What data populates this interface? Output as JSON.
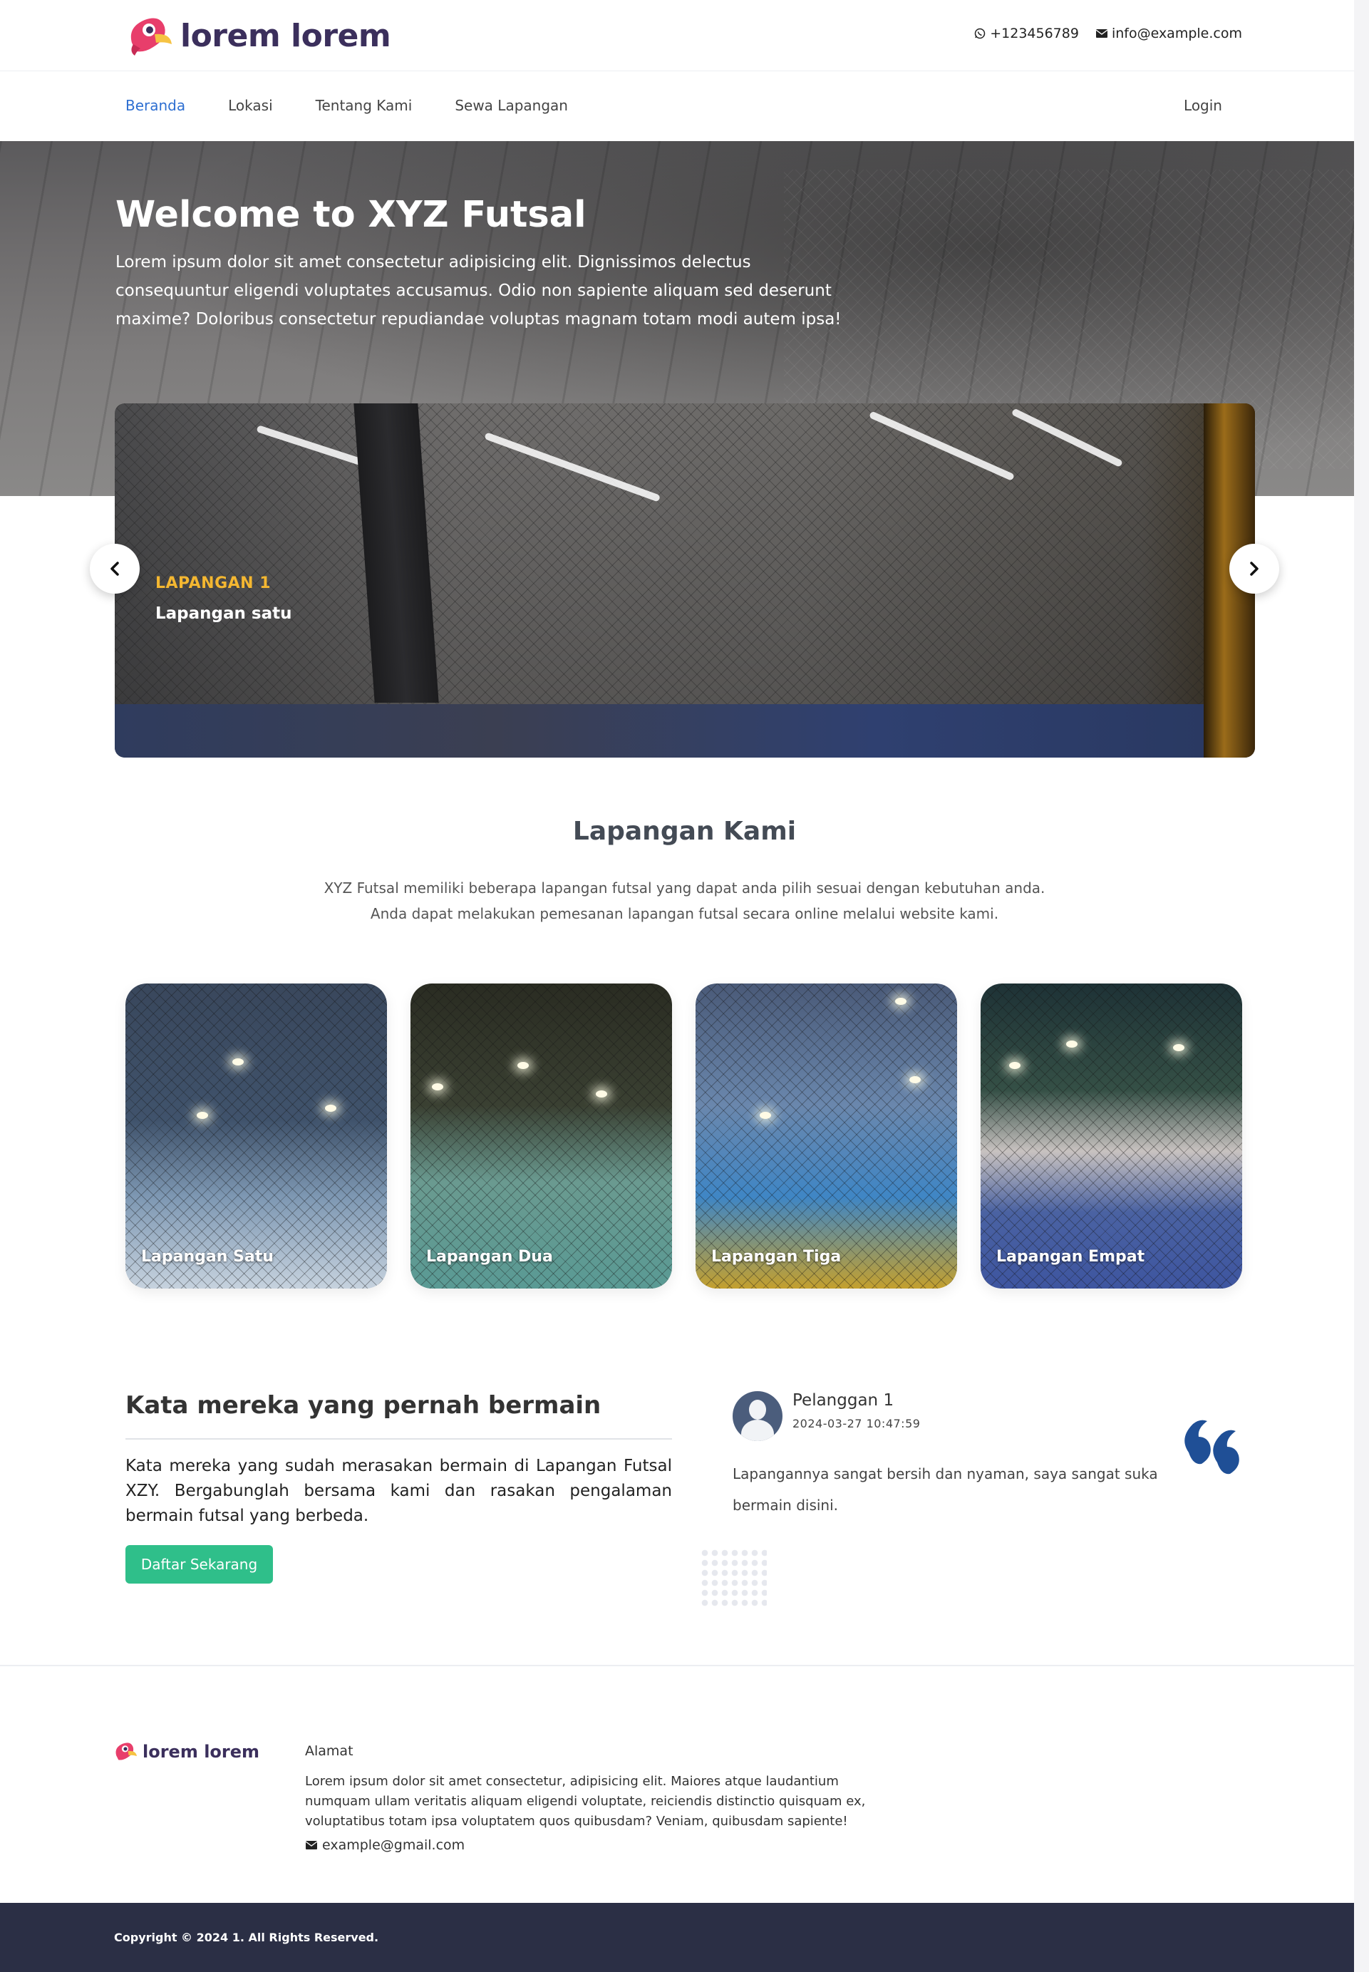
{
  "brand": {
    "name": "lorem lorem",
    "footer_name": "lorem lorem"
  },
  "contact": {
    "phone": "+123456789",
    "email": "info@example.com"
  },
  "nav": {
    "items": [
      {
        "label": "Beranda",
        "active": true
      },
      {
        "label": "Lokasi",
        "active": false
      },
      {
        "label": "Tentang Kami",
        "active": false
      },
      {
        "label": "Sewa Lapangan",
        "active": false
      }
    ],
    "login": "Login"
  },
  "hero": {
    "title": "Welcome to XYZ Futsal",
    "description": "Lorem ipsum dolor sit amet consectetur adipisicing elit. Dignissimos delectus consequuntur eligendi voluptates accusamus. Odio non sapiente aliquam sed deserunt maxime? Doloribus consectetur repudiandae voluptas magnam totam modi autem ipsa!"
  },
  "carousel": {
    "kicker": "LAPANGAN 1",
    "caption": "Lapangan satu"
  },
  "fields_section": {
    "title": "Lapangan Kami",
    "description_line1": "XYZ Futsal memiliki beberapa lapangan futsal yang dapat anda pilih sesuai dengan kebutuhan anda.",
    "description_line2": "Anda dapat melakukan pemesanan lapangan futsal secara online melalui website kami.",
    "cards": [
      {
        "label": "Lapangan Satu"
      },
      {
        "label": "Lapangan Dua"
      },
      {
        "label": "Lapangan Tiga"
      },
      {
        "label": "Lapangan Empat"
      }
    ]
  },
  "testimonials": {
    "title": "Kata mereka yang pernah bermain",
    "text": "Kata mereka yang sudah merasakan bermain di Lapangan Futsal XZY. Bergabunglah bersama kami dan rasakan pengalaman bermain futsal yang berbeda.",
    "cta": "Daftar Sekarang",
    "review": {
      "name": "Pelanggan 1",
      "date": "2024-03-27 10:47:59",
      "text": "Lapangannya sangat bersih dan nyaman, saya sangat suka bermain disini."
    }
  },
  "footer": {
    "address_label": "Alamat",
    "address": "Lorem ipsum dolor sit amet consectetur, adipisicing elit. Maiores atque laudantium numquam ullam veritatis aliquam eligendi voluptate, reiciendis distinctio quisquam ex, voluptatibus totam ipsa voluptatem quos quibusdam? Veniam, quibusdam sapiente!",
    "email": "example@gmail.com",
    "copyright": "Copyright © 2024 1. All Rights Reserved."
  },
  "colors": {
    "nav_active": "#2e6fd1",
    "kicker": "#f4b731",
    "cta": "#2fbf8a",
    "footer_bar": "#2b2f45",
    "brand_text": "#3b2f5c"
  }
}
